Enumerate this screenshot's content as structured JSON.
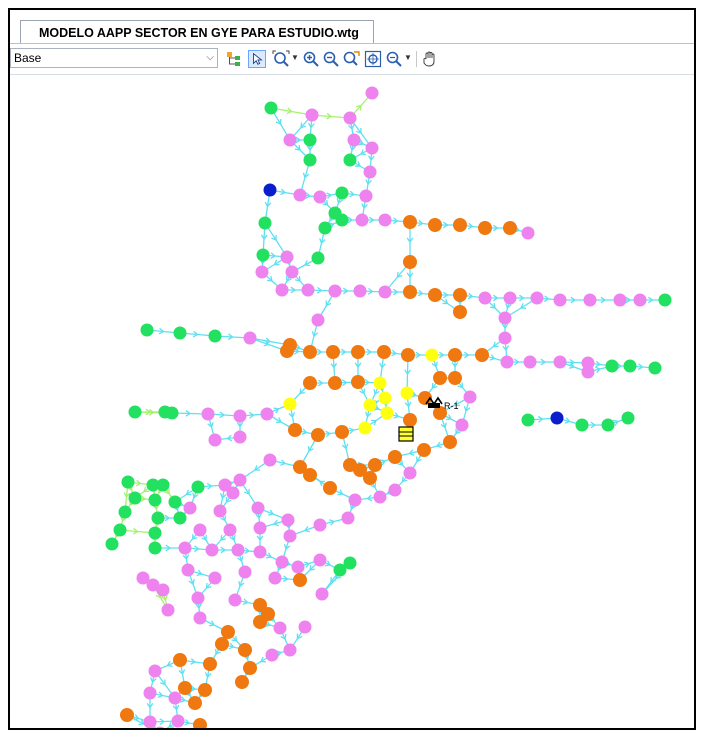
{
  "document_tab": {
    "title": "MODELO AAPP SECTOR EN GYE PARA ESTUDIO.wtg"
  },
  "toolbar": {
    "scenario_selected": "Base",
    "tools": [
      "element-tree-icon",
      "select-pointer-icon",
      "zoom-extents-icon",
      "zoom-in-icon",
      "zoom-out-icon",
      "zoom-window-icon",
      "zoom-center-icon",
      "zoom-previous-icon",
      "pan-hand-icon"
    ]
  },
  "colors": {
    "pipe": "#5fe0f0",
    "pipe_green": "#a6f070",
    "node_pink": "#ee82ee",
    "node_orange": "#f07810",
    "node_green": "#22e060",
    "node_yellow": "#ffff10",
    "node_blue": "#0a1ecc",
    "selection_tool": "#dbeaff"
  },
  "canvas": {
    "labels": {
      "reservoir_label": "R-1"
    }
  }
}
